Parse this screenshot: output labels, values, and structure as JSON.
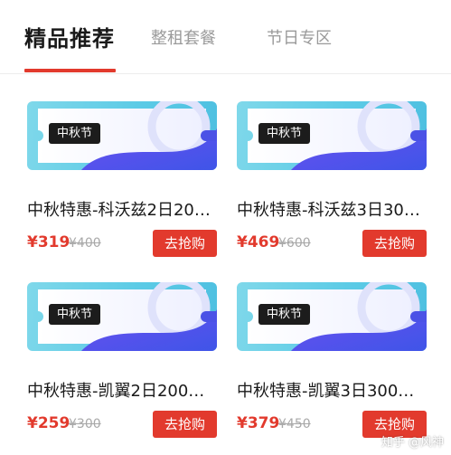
{
  "tabs": [
    {
      "label": "精品推荐",
      "active": true
    },
    {
      "label": "整租套餐",
      "active": false
    },
    {
      "label": "节日专区",
      "active": false
    }
  ],
  "colors": {
    "accent": "#e23a2d",
    "coupon_cyan": "#5ccbe6",
    "coupon_blue": "#4a4fe6"
  },
  "products": [
    {
      "badge": "中秋节",
      "title": "中秋特惠-科沃兹2日20…",
      "price": "¥319",
      "original_price": "¥400",
      "button": "去抢购"
    },
    {
      "badge": "中秋节",
      "title": "中秋特惠-科沃兹3日30…",
      "price": "¥469",
      "original_price": "¥600",
      "button": "去抢购"
    },
    {
      "badge": "中秋节",
      "title": "中秋特惠-凯翼2日200…",
      "price": "¥259",
      "original_price": "¥300",
      "button": "去抢购"
    },
    {
      "badge": "中秋节",
      "title": "中秋特惠-凯翼3日300…",
      "price": "¥379",
      "original_price": "¥450",
      "button": "去抢购"
    }
  ],
  "watermark": "知乎 @风神"
}
